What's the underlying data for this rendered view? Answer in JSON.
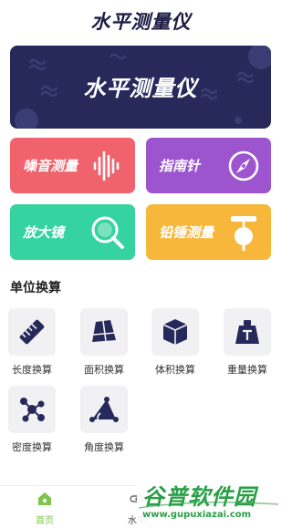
{
  "header": {
    "title": "水平测量仪"
  },
  "banner": {
    "title": "水平测量仪"
  },
  "tools": [
    {
      "label": "噪音测量",
      "icon": "sound-wave-icon",
      "color": "#f0626c"
    },
    {
      "label": "指南针",
      "icon": "compass-icon",
      "color": "#9c55cf"
    },
    {
      "label": "放大镜",
      "icon": "magnifier-icon",
      "color": "#35d39f"
    },
    {
      "label": "铅锤测量",
      "icon": "plumb-bob-icon",
      "color": "#f6b73a"
    }
  ],
  "unit_section": {
    "title": "单位换算",
    "items": [
      {
        "label": "长度换算",
        "icon": "ruler-icon"
      },
      {
        "label": "面积换算",
        "icon": "area-icon"
      },
      {
        "label": "体积换算",
        "icon": "cube-icon"
      },
      {
        "label": "重量换算",
        "icon": "weight-icon"
      },
      {
        "label": "密度换算",
        "icon": "molecule-icon"
      },
      {
        "label": "角度换算",
        "icon": "angle-icon"
      }
    ]
  },
  "tab_bar": {
    "tabs": [
      {
        "label": "首页",
        "icon": "home-icon",
        "active": true
      },
      {
        "label": "水平",
        "icon": "level-icon",
        "active": false
      }
    ]
  },
  "watermark": {
    "brand": "谷普软件园",
    "url": "www.gupuxiazai.com"
  },
  "colors": {
    "primary_dark": "#27295a",
    "accent_green": "#7dc44a",
    "watermark_green": "#2a9f47"
  }
}
